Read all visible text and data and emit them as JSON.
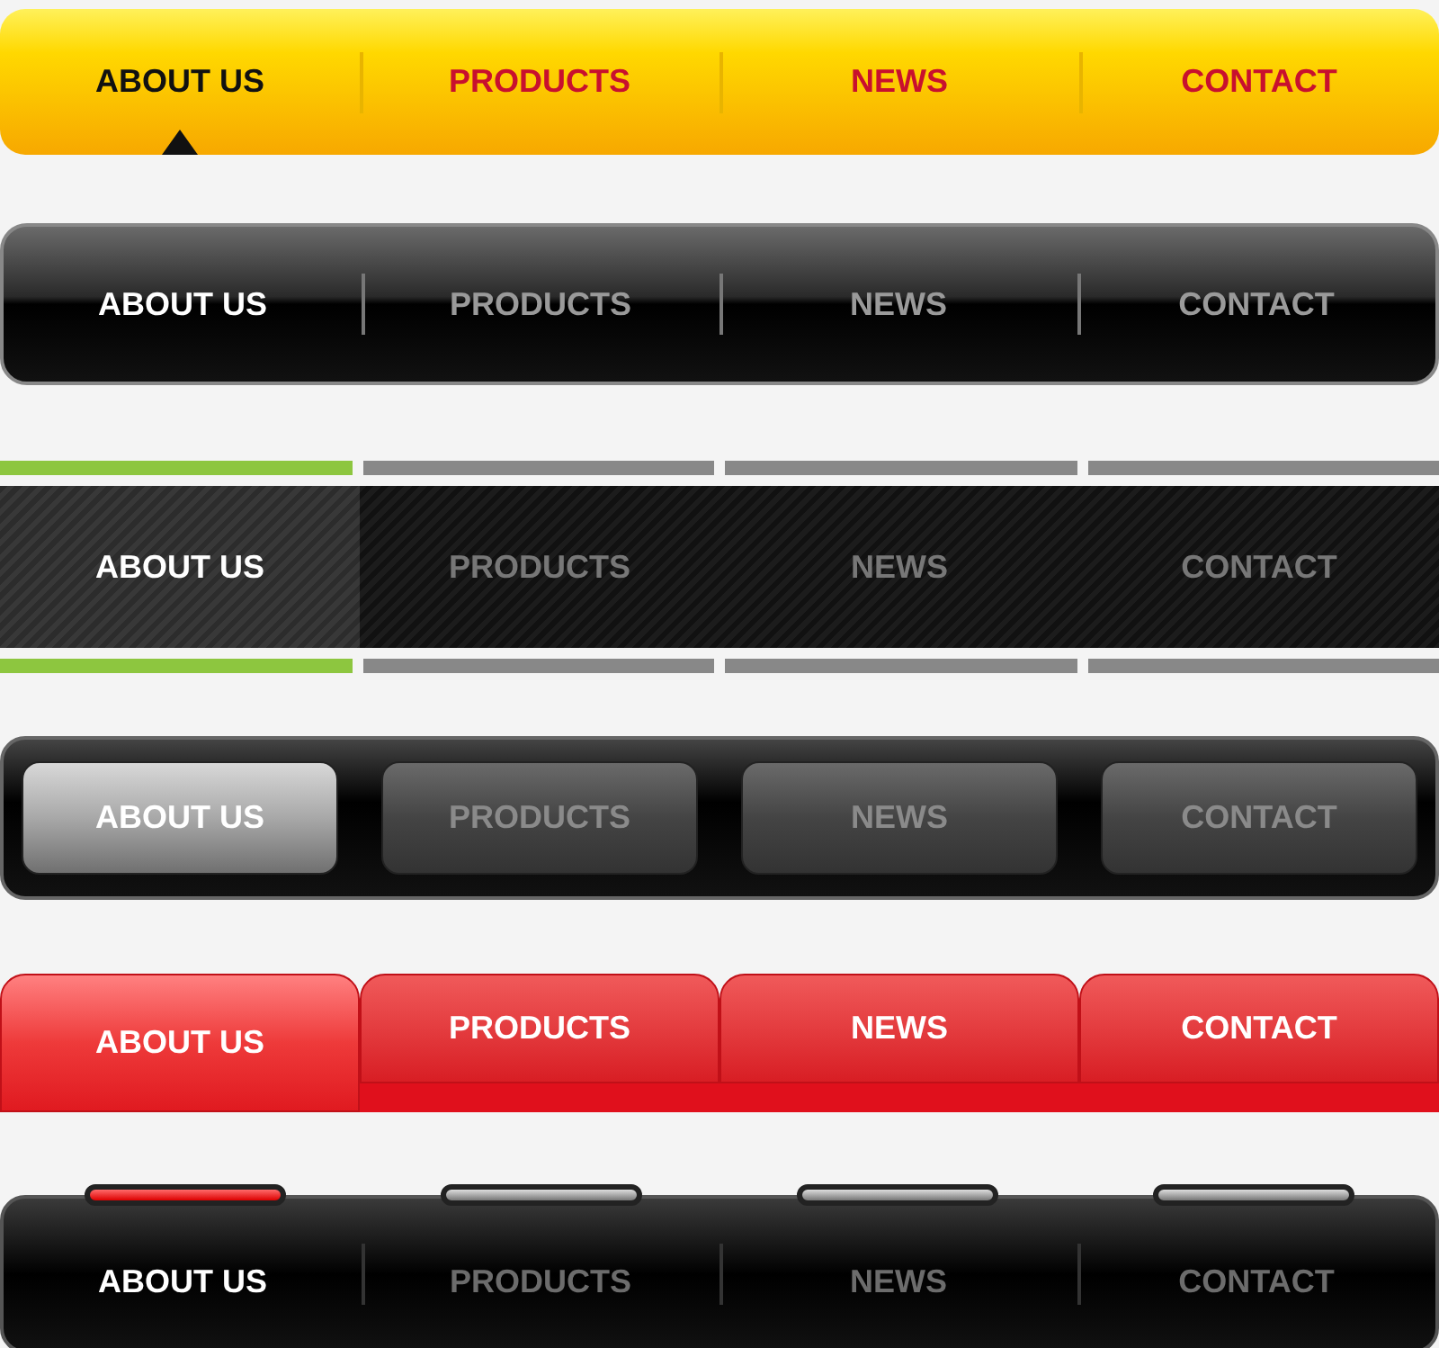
{
  "navbars": [
    {
      "kind": "yellow",
      "items": [
        {
          "label": "ABOUT US",
          "selected": true
        },
        {
          "label": "PRODUCTS",
          "selected": false
        },
        {
          "label": "NEWS",
          "selected": false
        },
        {
          "label": "CONTACT",
          "selected": false
        }
      ]
    },
    {
      "kind": "glossy",
      "items": [
        {
          "label": "ABOUT US",
          "selected": true
        },
        {
          "label": "PRODUCTS",
          "selected": false
        },
        {
          "label": "NEWS",
          "selected": false
        },
        {
          "label": "CONTACT",
          "selected": false
        }
      ]
    },
    {
      "kind": "striped",
      "items": [
        {
          "label": "ABOUT US",
          "selected": true
        },
        {
          "label": "PRODUCTS",
          "selected": false
        },
        {
          "label": "NEWS",
          "selected": false
        },
        {
          "label": "CONTACT",
          "selected": false
        }
      ]
    },
    {
      "kind": "buttons",
      "items": [
        {
          "label": "ABOUT US",
          "selected": true
        },
        {
          "label": "PRODUCTS",
          "selected": false
        },
        {
          "label": "NEWS",
          "selected": false
        },
        {
          "label": "CONTACT",
          "selected": false
        }
      ]
    },
    {
      "kind": "tabs",
      "items": [
        {
          "label": "ABOUT US",
          "selected": true
        },
        {
          "label": "PRODUCTS",
          "selected": false
        },
        {
          "label": "NEWS",
          "selected": false
        },
        {
          "label": "CONTACT",
          "selected": false
        }
      ]
    },
    {
      "kind": "pills",
      "items": [
        {
          "label": "ABOUT US",
          "selected": true
        },
        {
          "label": "PRODUCTS",
          "selected": false
        },
        {
          "label": "NEWS",
          "selected": false
        },
        {
          "label": "CONTACT",
          "selected": false
        }
      ]
    }
  ]
}
